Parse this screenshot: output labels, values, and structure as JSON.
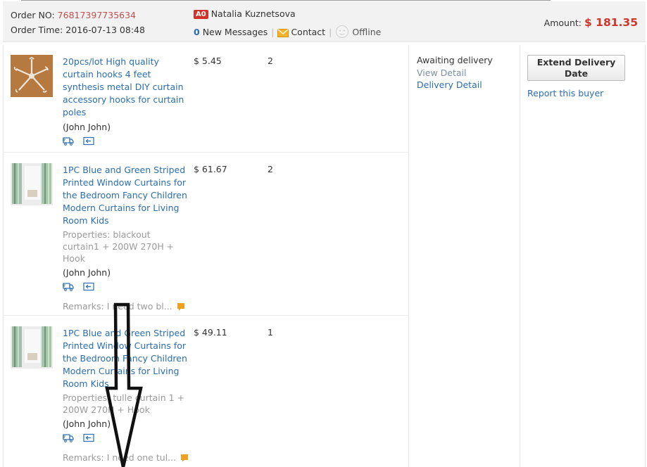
{
  "header": {
    "order_no_label": "Order NO:",
    "order_no": "76817397735634",
    "order_time_label": "Order Time:",
    "order_time": "2016-07-13 08:48",
    "buyer_badge": "A0",
    "buyer_name": "Natalia Kuznetsova",
    "new_messages_count": "0",
    "new_messages_label": "New Messages",
    "contact_label": "Contact",
    "online_status": "Offline",
    "amount_label": "Amount:",
    "amount_value": "$ 181.35"
  },
  "items": [
    {
      "title": "20pcs/lot High quality curtain hooks 4 feet synthesis metal DIY curtain accessory hooks for curtain poles",
      "properties": "",
      "buyer": "(John John)",
      "price": "$ 5.45",
      "qty": "2",
      "remarks": ""
    },
    {
      "title": "1PC Blue and Green Striped Printed Window Curtains for the Bedroom Fancy Children Modern Curtains for Living Room Kids",
      "properties": "Properties: blackout curtain1 + 200W 270H + Hook",
      "buyer": "(John John)",
      "price": "$ 61.67",
      "qty": "2",
      "remarks": "Remarks: I need two bl..."
    },
    {
      "title": "1PC Blue and Green Striped Printed Window Curtains for the Bedroom Fancy Children Modern Curtains for Living Room Kids",
      "properties": "Properties: tulle curtain 1 + 200W 270H + Hook",
      "buyer": "(John John)",
      "price": "$ 49.11",
      "qty": "1",
      "remarks": "Remarks: I need one tul..."
    }
  ],
  "status": {
    "state": "Awaiting delivery",
    "view_detail": "View Detail",
    "delivery_detail": "Delivery Detail"
  },
  "actions": {
    "extend_delivery_date": "Extend Delivery Date",
    "report_buyer": "Report this buyer"
  },
  "colors": {
    "link": "#2a6db0",
    "amount": "#d0352a",
    "order_no": "#c0504d",
    "header_bg": "#f2f2f2",
    "remark_flag": "#f0a020"
  },
  "icons": [
    "envelope-icon",
    "offline-face-icon",
    "shipping-truck-icon",
    "return-icon",
    "remark-flag-icon"
  ]
}
